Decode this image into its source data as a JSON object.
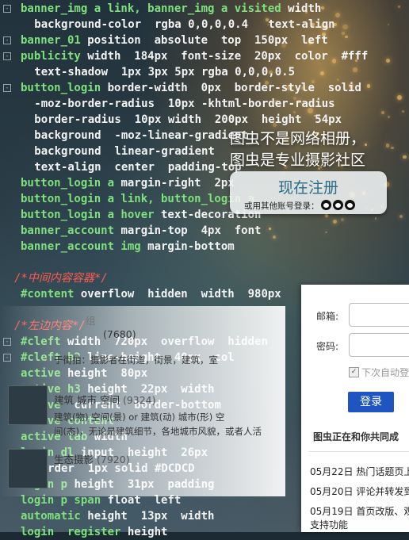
{
  "code_lines": [
    {
      "sel": "banner_img a link, banner_img a visited",
      "rest": " width",
      "g": "⊟"
    },
    {
      "sel": "",
      "rest": "   background-color  rgba 0,0,0,0.4   text-align",
      "g": ""
    },
    {
      "sel": "banner_01",
      "rest": " position  absolute  top  150px  left",
      "g": "⊟"
    },
    {
      "sel": "publicity",
      "rest": " width  184px  font-size  20px  color  #fff",
      "g": "⊟"
    },
    {
      "sel": "",
      "rest": "   text-shadow  1px 3px 5px rgba 0,0,0,0.5",
      "g": ""
    },
    {
      "sel": "button_login",
      "rest": " border-width  0px  border-style  solid",
      "g": "⊟"
    },
    {
      "sel": "",
      "rest": "   -moz-border-radius  10px -khtml-border-radius",
      "g": ""
    },
    {
      "sel": "",
      "rest": "   border-radius  10px width  200px  height  54px",
      "g": ""
    },
    {
      "sel": "",
      "rest": "   background  -moz-linear-gradient",
      "g": ""
    },
    {
      "sel": "",
      "rest": "   background  linear-gradient",
      "g": ""
    },
    {
      "sel": "",
      "rest": "   text-align  center  padding-top",
      "g": ""
    },
    {
      "sel": "button_login a",
      "rest": " margin-right  2px",
      "g": ""
    },
    {
      "sel": "button_login a link, button_login a",
      "rest": "",
      "g": ""
    },
    {
      "sel": "button_login a hover",
      "rest": " text-decoration",
      "g": ""
    },
    {
      "sel": "banner_account",
      "rest": " margin-top  4px  font",
      "g": ""
    },
    {
      "sel": "banner_account img",
      "rest": " margin-bottom",
      "g": ""
    },
    {
      "sel": "",
      "rest": "",
      "g": ""
    },
    {
      "sel": "",
      "rest": "/*中间内容容器*/",
      "g": "",
      "cmt": true
    },
    {
      "sel": "#content",
      "rest": " overflow  hidden  width  980px",
      "g": ""
    },
    {
      "sel": "",
      "rest": "",
      "g": ""
    },
    {
      "sel": "",
      "rest": "/*左边内容*/",
      "g": "",
      "cmt": true
    },
    {
      "sel": "#cleft",
      "rest": " width  720px  overflow  hidden",
      "g": "⊟"
    },
    {
      "sel": "#cleft h2",
      "rest": " line-height  40px  col",
      "g": "⊟"
    },
    {
      "sel": "active",
      "rest": " height  80px",
      "g": ""
    },
    {
      "sel": "active h3",
      "rest": " height  22px  width",
      "g": ""
    },
    {
      "sel": "active",
      "rest": "  current  border-bottom",
      "g": ""
    },
    {
      "sel": "active content",
      "rest": "",
      "g": ""
    },
    {
      "sel": "active tab",
      "rest": " width",
      "g": ""
    },
    {
      "sel": "login dl",
      "rest": " input  height  26px",
      "g": ""
    },
    {
      "sel": "",
      "rest": "   border  1px solid #DCDCD",
      "g": ""
    },
    {
      "sel": "login p",
      "rest": " height  31px  padding",
      "g": ""
    },
    {
      "sel": "login p span",
      "rest": " float  left",
      "g": ""
    },
    {
      "sel": "automatic",
      "rest": " height  13px  width",
      "g": ""
    },
    {
      "sel": "login  register",
      "rest": " height",
      "g": ""
    }
  ],
  "slogan": {
    "line1_em": "图虫",
    "line1": "不是网络相册，",
    "line2": "图虫是专业摄影社区"
  },
  "register": {
    "button": "现在注册",
    "alt_prefix": "或用其他账号登录："
  },
  "left_list": {
    "group_label": "组",
    "items": [
      {
        "title": "(7680)",
        "desc1": "于街拍：摄影者在街道，街景，建筑，室",
        "desc2": "active  拍摄的以人物为主的图片，"
      },
      {
        "title": "建筑 城市 空间",
        "count": "(9324)",
        "desc1": "建筑(物) 空间(景) or 建筑(动) 城市(形) 空",
        "desc2": "间(态)，无论是建筑细节，各地城市风貌，或者人活"
      },
      {
        "title": "生态摄影",
        "count": "(7920)",
        "desc1": "",
        "desc2": ""
      }
    ]
  },
  "login": {
    "email_label": "邮箱:",
    "password_label": "密码:",
    "auto_login": "下次自动登",
    "login_button": "登录",
    "section_title": "图虫正在和你共同成",
    "news": [
      "05月22日 热门话题页上",
      "05月20日 评论并转发到",
      "05月19日 首页改版、观",
      "支持功能"
    ]
  }
}
